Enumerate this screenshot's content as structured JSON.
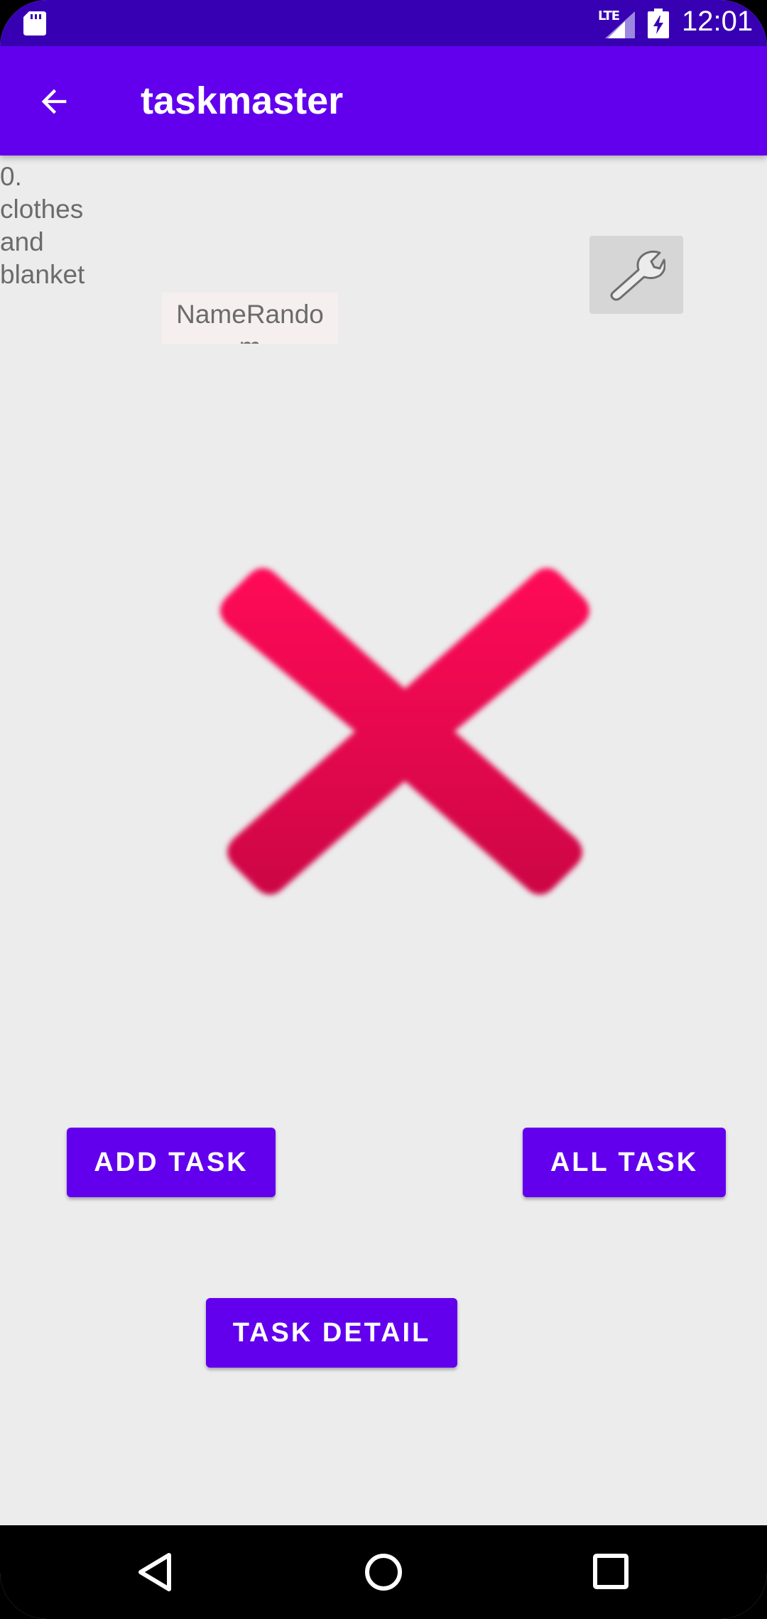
{
  "status_bar": {
    "network_label": "LTE",
    "time": "12:01",
    "icons": [
      "sd-card-icon",
      "signal-icon",
      "battery-charging-icon"
    ]
  },
  "app_bar": {
    "title": "taskmaster",
    "back_icon": "arrow-back-icon"
  },
  "task": {
    "title_lines": [
      "0.",
      "clothes",
      "and",
      "blanket"
    ],
    "name_value": "NameRandom"
  },
  "settings_button": {
    "icon": "wrench-icon"
  },
  "image": {
    "icon": "close-x-icon",
    "color": "#e2074f"
  },
  "buttons": {
    "add_task": "ADD TASK",
    "all_task": "ALL TASK",
    "task_detail": "TASK DETAIL"
  },
  "nav_bar": {
    "icons": [
      "nav-back-icon",
      "nav-home-icon",
      "nav-recents-icon"
    ]
  },
  "colors": {
    "primary": "#6200ee",
    "primary_dark": "#3700b3",
    "background": "#ececed",
    "text_secondary": "#6b6b6b"
  }
}
